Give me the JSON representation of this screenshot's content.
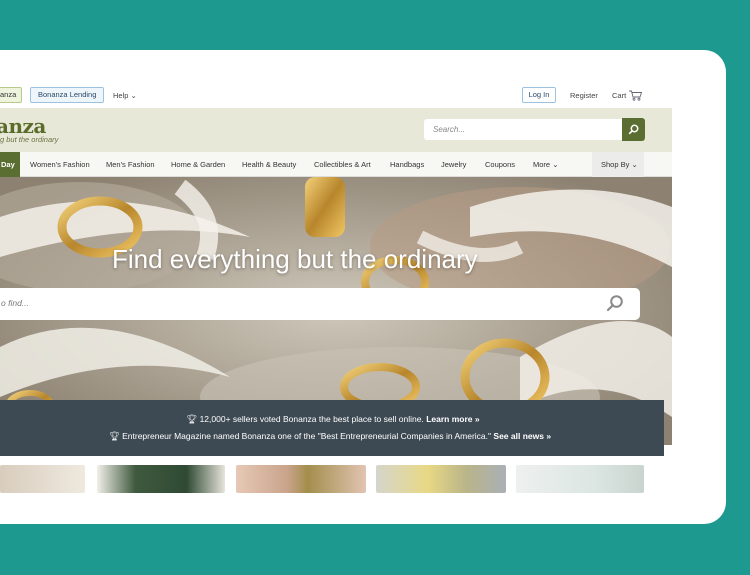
{
  "topbar": {
    "brand_pill": "anza",
    "lending_pill": "Bonanza Lending",
    "help_label": "Help",
    "login_label": "Log In",
    "register_label": "Register",
    "cart_label": "Cart"
  },
  "header": {
    "logo_text": "anza",
    "tagline": "g but the ordinary",
    "search_placeholder": "Search..."
  },
  "nav": {
    "day_label": "Day",
    "items": [
      "Women's Fashion",
      "Men's Fashion",
      "Home & Garden",
      "Health & Beauty",
      "Collectibles & Art",
      "Handbags",
      "Jewelry",
      "Coupons",
      "More"
    ],
    "shop_by": "Shop By"
  },
  "hero": {
    "title": "Find everything but the ordinary",
    "search_placeholder": "o find..."
  },
  "announce": {
    "line1_text": "12,000+ sellers voted Bonanza the best place to sell online.",
    "line1_link": "Learn more »",
    "line2_text": "Entrepreneur Magazine named Bonanza one of the \"Best Entrepreneurial Companies in America.\"",
    "line2_link": "See all news »"
  },
  "colors": {
    "background": "#1e9990",
    "brand_green": "#5b6e32",
    "announce_bg": "#3e4a53"
  }
}
